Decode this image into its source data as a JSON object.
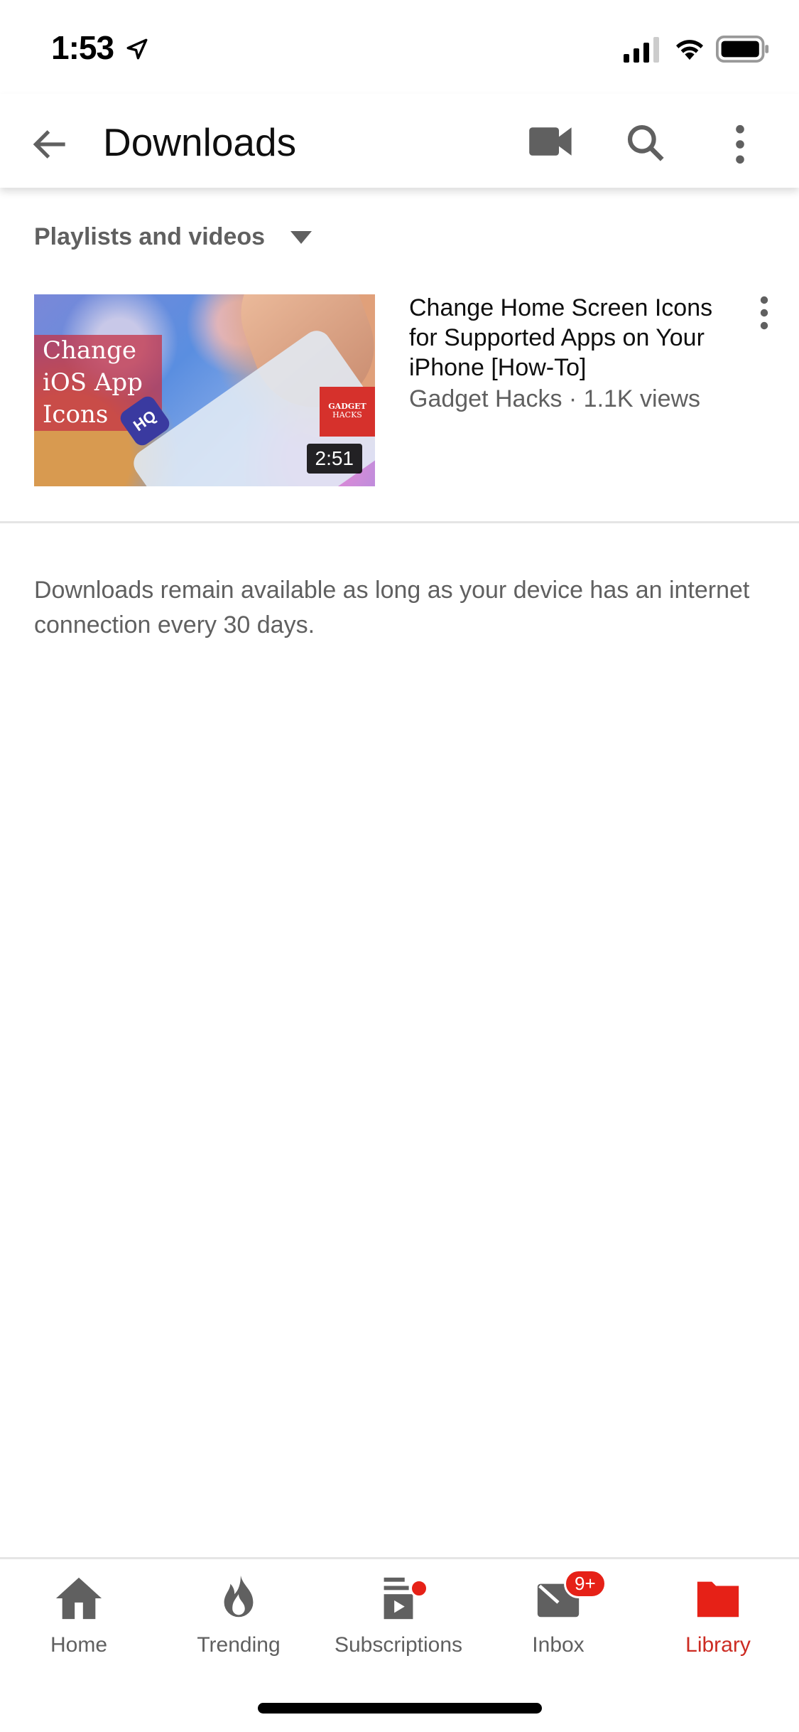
{
  "status_bar": {
    "time": "1:53",
    "icons": [
      "location-arrow-icon",
      "cellular-signal-icon",
      "wifi-icon",
      "battery-icon"
    ]
  },
  "header": {
    "title": "Downloads",
    "icons": [
      "back-arrow-icon",
      "video-camera-icon",
      "search-icon",
      "more-vertical-icon"
    ]
  },
  "filter": {
    "label": "Playlists and videos",
    "icon": "caret-down-icon"
  },
  "videos": [
    {
      "title": "Change Home Screen Icons for Supported Apps on Your iPhone [How-To]",
      "channel": "Gadget Hacks",
      "views": "1.1K views",
      "meta": "Gadget Hacks · 1.1K views",
      "duration": "2:51",
      "thumbnail": {
        "overlay_text": "Change iOS App Icons",
        "app_badge": "HQ",
        "brand_line1": "GADGET",
        "brand_line2": "HACKS"
      }
    }
  ],
  "note": "Downloads remain available as long as your device has an internet connection every 30 days.",
  "tabs": [
    {
      "label": "Home",
      "icon": "home-icon",
      "active": false
    },
    {
      "label": "Trending",
      "icon": "flame-icon",
      "active": false
    },
    {
      "label": "Subscriptions",
      "icon": "subscriptions-icon",
      "active": false,
      "dot": true
    },
    {
      "label": "Inbox",
      "icon": "inbox-icon",
      "active": false,
      "badge": "9+"
    },
    {
      "label": "Library",
      "icon": "library-folder-icon",
      "active": true
    }
  ],
  "colors": {
    "accent": "#e62117",
    "active_tab": "#cc2b22",
    "icon_gray": "#606060",
    "text_secondary": "#606060"
  }
}
